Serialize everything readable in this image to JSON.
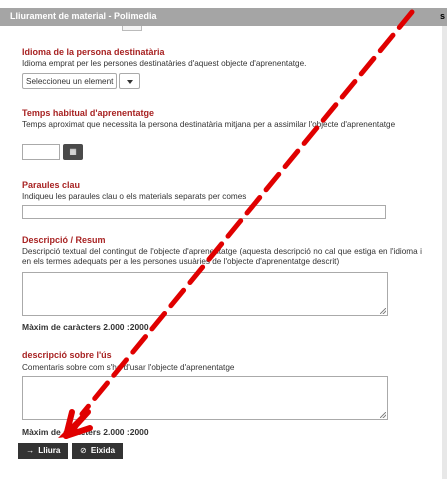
{
  "window": {
    "title": "Lliurament de material - Polimedia",
    "edge_letter": "s"
  },
  "language": {
    "label": "Idioma de la persona destinatària",
    "help": "Idioma emprat per les persones destinatàries d'aquest objecte d'aprenentatge.",
    "select_value": "Seleccioneu un element"
  },
  "learning_time": {
    "label": "Temps habitual d'aprenentatge",
    "help": "Temps aproximat que necessita la persona destinatària mitjana per a assimilar l'objecte d'aprenentatge",
    "calendar_icon": "calendar-icon"
  },
  "keywords": {
    "label": "Paraules clau",
    "help": "Indiqueu les paraules clau o els materials separats per comes"
  },
  "description": {
    "label": "Descripció / Resum",
    "help": "Descripció textual del contingut de l'objecte d'aprenentatge (aquesta descripció no cal que estiga en l'idioma i en els termes adequats per a les persones usuàries de l'objecte d'aprenentatge descrit)",
    "max_chars": "Màxim de caràcters 2.000 :2000"
  },
  "usage": {
    "label": "descripció sobre l'ús",
    "help": "Comentaris sobre com s'ha d'usar l'objecte d'aprenentatge",
    "max_chars": "Màxim de caràcters 2.000 :2000"
  },
  "actions": {
    "submit_icon": "→",
    "submit_label": "Lliura",
    "exit_icon": "⊘",
    "exit_label": "Eixida"
  },
  "colors": {
    "accent": "#a82323",
    "arrow": "#e00000",
    "titlebar": "#a5a5a5"
  }
}
